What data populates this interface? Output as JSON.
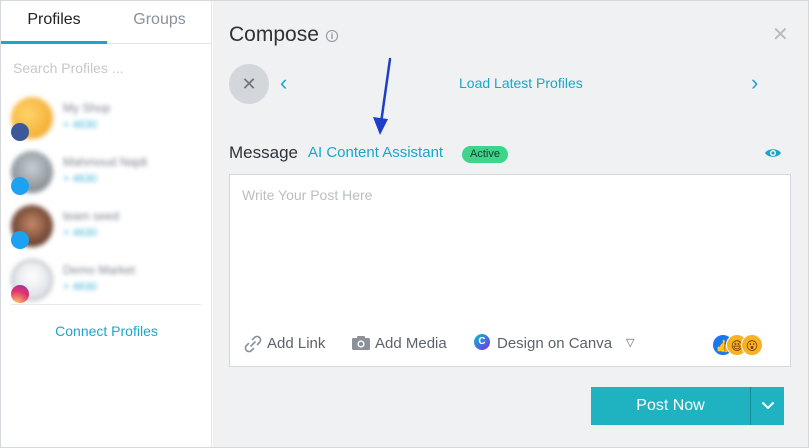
{
  "tabs": [
    {
      "label": "Profiles",
      "active": true
    },
    {
      "label": "Groups",
      "active": false
    }
  ],
  "search": {
    "placeholder": "Search Profiles ..."
  },
  "profiles": [
    {
      "name": "My Shop",
      "sub": "+ 4630",
      "network": "facebook",
      "network_color": "#3b5998",
      "avatar_color": "#f0b429"
    },
    {
      "name": "Mahmoud Najdi",
      "sub": "+ 4630",
      "network": "twitter",
      "network_color": "#1da1f2",
      "avatar_color": "#9aa4ad"
    },
    {
      "name": "team seed",
      "sub": "+ 4630",
      "network": "twitter",
      "network_color": "#1da1f2",
      "avatar_color": "#4a2a1e"
    },
    {
      "name": "Demo Market",
      "sub": "+ 4630",
      "network": "instagram",
      "network_color": "#e1306c",
      "avatar_color": "#e8ecf0"
    }
  ],
  "connect_profiles": "Connect Profiles",
  "compose": {
    "title": "Compose",
    "load_latest": "Load Latest Profiles",
    "message_label": "Message",
    "ai_label": "AI Content Assistant",
    "ai_status": "Active",
    "editor_placeholder": "Write Your Post Here",
    "tools": {
      "add_link": "Add Link",
      "add_media": "Add Media",
      "design_canva": "Design on Canva"
    },
    "post_button": "Post Now"
  },
  "colors": {
    "accent": "#1ba6c9",
    "active_badge": "#3ed48a",
    "post_button": "#1fb2c0",
    "annotation_arrow": "#1d3fc7"
  }
}
